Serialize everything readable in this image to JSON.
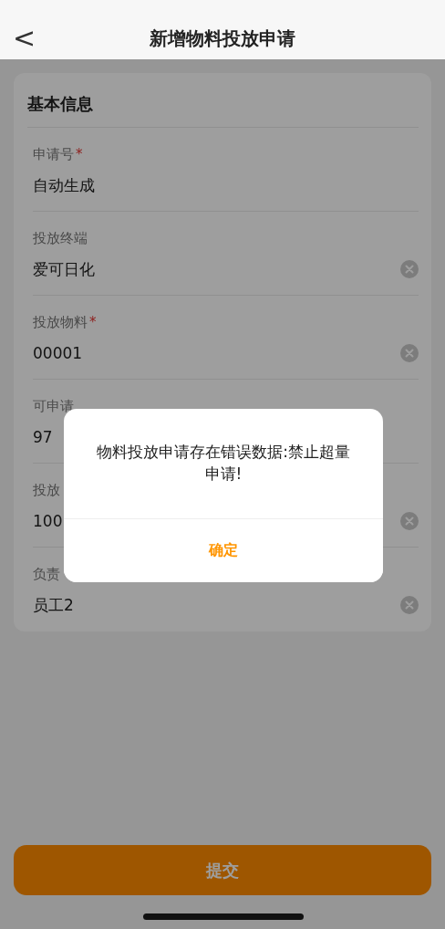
{
  "nav": {
    "back": "<",
    "title": "新增物料投放申请"
  },
  "section": {
    "title": "基本信息"
  },
  "fields": [
    {
      "label": "申请号",
      "required_mark": "*",
      "value": "自动生成",
      "clearable": false
    },
    {
      "label": "投放终端",
      "value": "爱可日化",
      "clearable": true
    },
    {
      "label": "投放物料",
      "required_mark": "*",
      "value": "00001",
      "clearable": true
    },
    {
      "label": "可申请",
      "value": "97",
      "clearable": false
    },
    {
      "label": "投放",
      "value": "100",
      "clearable": true
    },
    {
      "label": "负责",
      "value": "员工2",
      "clearable": true
    }
  ],
  "submit": {
    "label": "提交"
  },
  "dialog": {
    "message": "物料投放申请存在错误数据:禁止超量申请!",
    "button": "确定"
  }
}
